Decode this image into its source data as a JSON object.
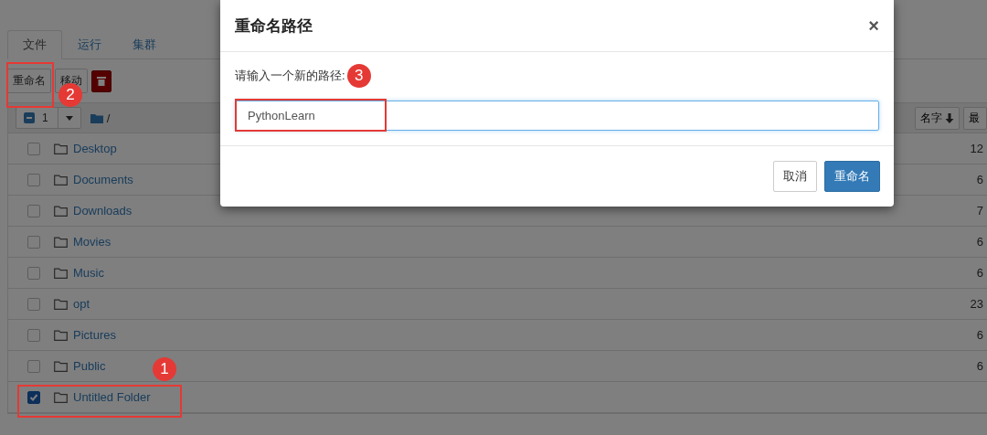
{
  "tabs": [
    {
      "label": "文件",
      "selected": true
    },
    {
      "label": "运行",
      "selected": false
    },
    {
      "label": "集群",
      "selected": false
    }
  ],
  "toolbar": {
    "rename_button": "重命名",
    "rename_callout": "2",
    "move_button": "移动"
  },
  "list_header": {
    "selected_count": "1",
    "path": "/",
    "sort_button": "名字",
    "column_3": "最"
  },
  "rows": [
    {
      "name": "Desktop",
      "checked": false,
      "column_3": "12"
    },
    {
      "name": "Documents",
      "checked": false,
      "column_3": "6"
    },
    {
      "name": "Downloads",
      "checked": false,
      "column_3": "7"
    },
    {
      "name": "Movies",
      "checked": false,
      "column_3": "6"
    },
    {
      "name": "Music",
      "checked": false,
      "column_3": "6"
    },
    {
      "name": "opt",
      "checked": false,
      "column_3": "23"
    },
    {
      "name": "Pictures",
      "checked": false,
      "column_3": "6"
    },
    {
      "name": "Public",
      "checked": false,
      "column_3": "6"
    },
    {
      "name": "Untitled Folder",
      "checked": true,
      "callout": "1"
    }
  ],
  "dialog": {
    "title": "重命名路径",
    "close": "×",
    "label": "请输入一个新的路径:",
    "label_callout": "3",
    "value": "PythonLearn",
    "cancel_button": "取消",
    "confirm_button": "重命名"
  }
}
